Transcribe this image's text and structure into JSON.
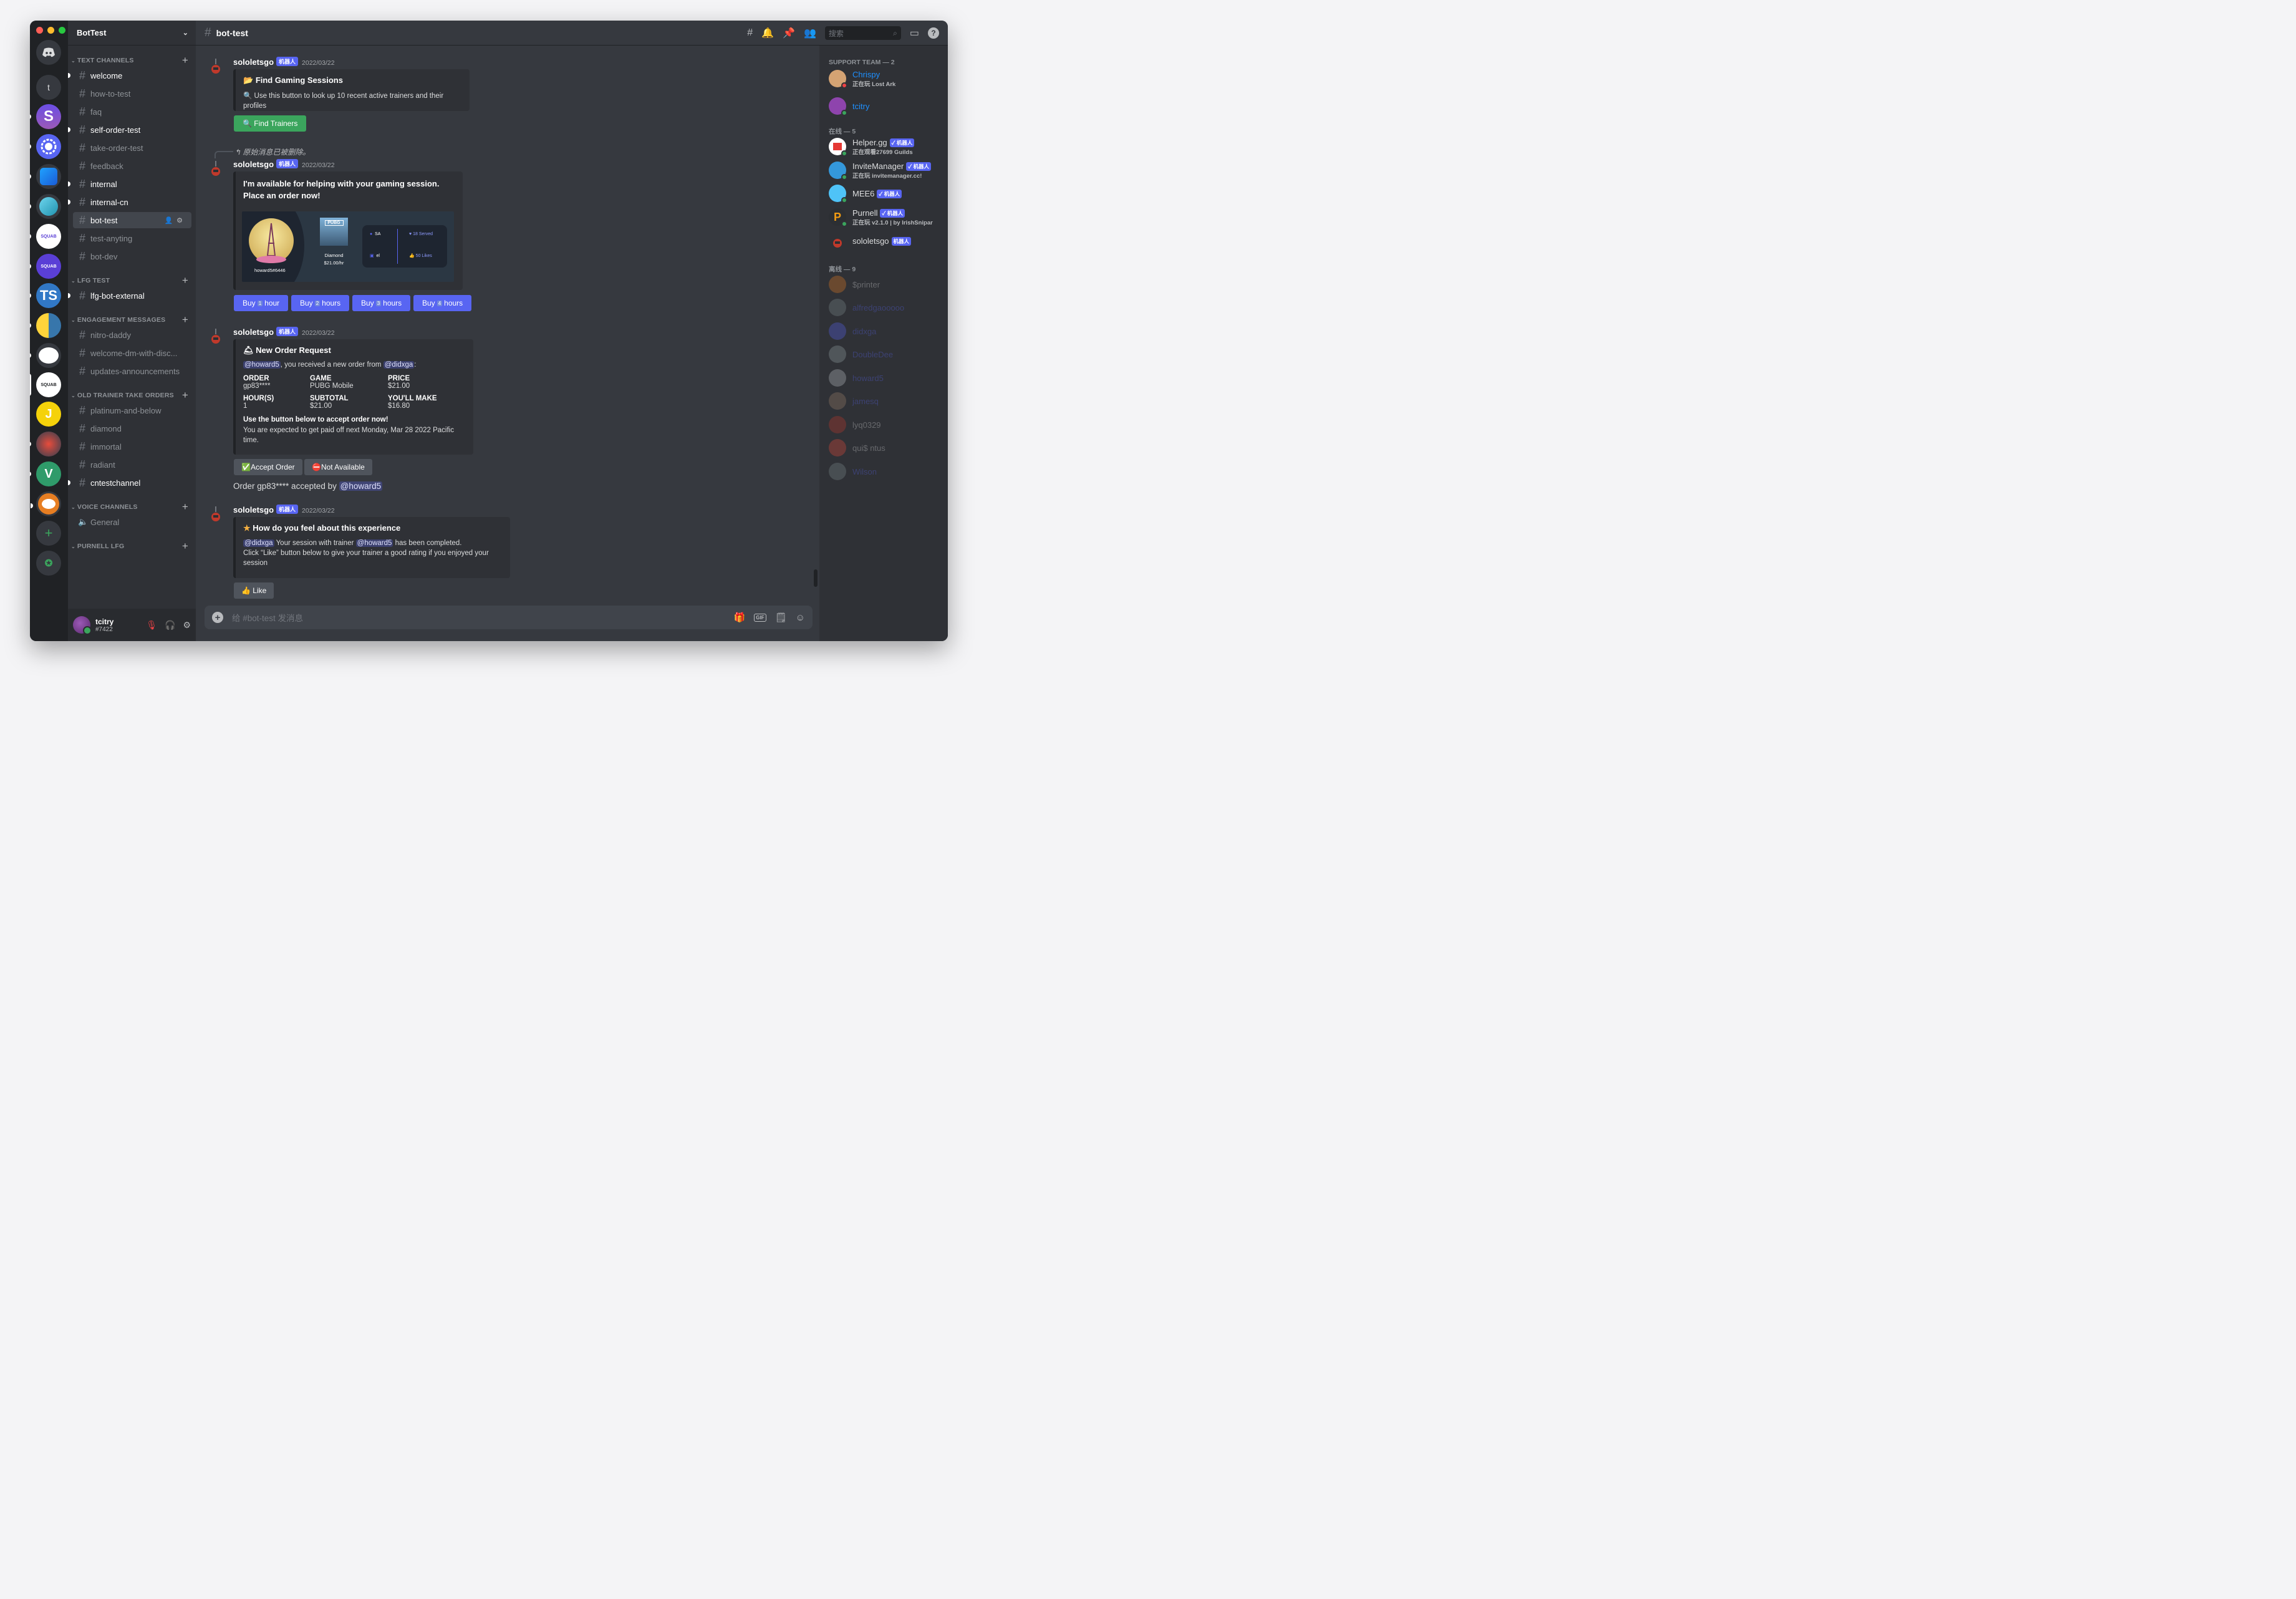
{
  "guild": {
    "name": "BotTest"
  },
  "rail": {
    "servers": [
      {
        "name": "Direct Messages",
        "label": "",
        "bg": "#36393f"
      },
      {
        "name": "t",
        "label": "t",
        "bg": "#36393f"
      },
      {
        "name": "S Team",
        "label": "S",
        "bg": "#6b4ee6"
      },
      {
        "name": "Discord",
        "label": "",
        "bg": "#5865f2"
      },
      {
        "name": "Xcode",
        "label": "",
        "bg": "#1f8ceb"
      },
      {
        "name": "Bubble",
        "label": "",
        "bg": "#3ea8c4"
      },
      {
        "name": "Squad",
        "label": "SQUAB",
        "bg": "#ffffff"
      },
      {
        "name": "Squad 2",
        "label": "SQUAB",
        "bg": "#5a3fd6"
      },
      {
        "name": "TS",
        "label": "TS",
        "bg": "#3178c6"
      },
      {
        "name": "Python",
        "label": "",
        "bg": "#3776ab"
      },
      {
        "name": "Reddit",
        "label": "",
        "bg": "#36393f"
      },
      {
        "name": "BotTest",
        "label": "SQUAB",
        "bg": "#ffffff"
      },
      {
        "name": "J",
        "label": "J",
        "bg": "#f5d20a"
      },
      {
        "name": "Art",
        "label": "",
        "bg": "#c0392b"
      },
      {
        "name": "Vue",
        "label": "V",
        "bg": "#2f9b6a"
      },
      {
        "name": "Owl",
        "label": "",
        "bg": "#e67e22"
      }
    ]
  },
  "channels": {
    "text_category": "TEXT CHANNELS",
    "lfg_category": "LFG TEST",
    "engagement_category": "ENGAGEMENT MESSAGES",
    "old_trainer_category": "OLD TRAINER TAKE ORDERS",
    "voice_category": "VOICE CHANNELS",
    "purnell_category": "PURNELL LFG",
    "text": [
      "welcome",
      "how-to-test",
      "faq",
      "self-order-test",
      "take-order-test",
      "feedback",
      "internal",
      "internal-cn",
      "bot-test",
      "test-anyting",
      "bot-dev"
    ],
    "lfg": [
      "lfg-bot-external"
    ],
    "engagement": [
      "nitro-daddy",
      "welcome-dm-with-disc...",
      "updates-announcements"
    ],
    "old_trainer": [
      "platinum-and-below",
      "diamond",
      "immortal",
      "radiant",
      "cntestchannel"
    ],
    "voice": [
      "General"
    ]
  },
  "user": {
    "name": "tcitry",
    "tag": "#7422"
  },
  "topbar": {
    "channel": "bot-test",
    "search_placeholder": "搜索"
  },
  "messages": {
    "author": "sololetsgo",
    "bot_badge": "机器人",
    "m1": {
      "time": "2022/03/22",
      "title": "Find Gaming Sessions",
      "desc": "Use this button to look up 10 recent active trainers and their profiles",
      "button": "Find Trainers"
    },
    "m2": {
      "reply": "原始消息已被删除。",
      "time": "2022/03/22",
      "title": "I'm available for helping with your gaming session. Place an order now!",
      "card": {
        "handle": "howard5#6446",
        "game_logo": "PUBG",
        "rank": "Diamond",
        "rate": "$21.00/hr",
        "region": "SA",
        "lang": "el",
        "served": "18 Served",
        "likes": "50 Likes"
      },
      "buttons": [
        {
          "pre": "Buy",
          "n": "1",
          "post": "hour"
        },
        {
          "pre": "Buy",
          "n": "2",
          "post": "hours"
        },
        {
          "pre": "Buy",
          "n": "3",
          "post": "hours"
        },
        {
          "pre": "Buy",
          "n": "4",
          "post": "hours"
        }
      ]
    },
    "m3": {
      "time": "2022/03/22",
      "title": "New Order Request",
      "mention1": "@howard5",
      "mid": ", you received a new order from",
      "mention2": "@didxga",
      "tail": ":",
      "order_h": "ORDER",
      "order_v": "gp83****",
      "game_h": "GAME",
      "game_v": "PUBG Mobile",
      "price_h": "PRICE",
      "price_v": "$21.00",
      "hours_h": "HOUR(S)",
      "hours_v": "1",
      "subtotal_h": "SUBTOTAL",
      "subtotal_v": "$21.00",
      "make_h": "YOU'LL MAKE",
      "make_v": "$16.80",
      "cta": "Use the button below to accept order now!",
      "note": "You are expected to get paid off next Monday, Mar 28 2022 Pacific time.",
      "accept": "Accept Order",
      "decline": "Not Available",
      "accepted_text": "Order gp83**** accepted by",
      "accepted_by": "@howard5"
    },
    "m4": {
      "time": "2022/03/22",
      "title": "How do you feel about this experience",
      "mention1": "@didxga",
      "mid": "Your session with trainer",
      "mention2": "@howard5",
      "tail": "has been completed.",
      "line2": "Click “Like” button below to give your trainer a good rating if you enjoyed your session",
      "button": "Like"
    }
  },
  "composer": {
    "placeholder": "给 #bot-test 发消息"
  },
  "members": {
    "support_header": "SUPPORT TEAM — 2",
    "online_header": "在线 — 5",
    "offline_header": "离线 — 9",
    "support": [
      {
        "name": "Chrispy",
        "status": "正在玩 Lost Ark",
        "color": "#1e90ff",
        "bg": "#d4a373"
      },
      {
        "name": "tcitry",
        "status": "",
        "color": "#1e90ff",
        "bg": "#8e44ad"
      }
    ],
    "online": [
      {
        "name": "Helper.gg",
        "status": "正在观看27699 Guilds",
        "badge": "✓ 机器人",
        "bg": "#e53935"
      },
      {
        "name": "InviteManager",
        "status": "正在玩 invitemanager.cc!",
        "badge": "✓ 机器人",
        "bg": "#3498db"
      },
      {
        "name": "MEE6",
        "status": "",
        "badge": "✓ 机器人",
        "bg": "#4fc3f7"
      },
      {
        "name": "Purnell",
        "status": "正在玩 v2.1.0 | by IrishSnipar",
        "badge": "✓ 机器人",
        "bg": "#f39c12"
      },
      {
        "name": "sololetsgo",
        "status": "",
        "badge": "机器人",
        "bg": "#c0392b"
      }
    ],
    "offline": [
      {
        "name": "$printer",
        "bg": "#e67e22",
        "color": "#dcddde"
      },
      {
        "name": "alfredgaooooo",
        "bg": "#7f8c8d",
        "color": "#5865f2"
      },
      {
        "name": "didxga",
        "bg": "#5865f2",
        "color": "#5865f2"
      },
      {
        "name": "DoubleDee",
        "bg": "#95a5a6",
        "color": "#5865f2"
      },
      {
        "name": "howard5",
        "bg": "#bdc3c7",
        "color": "#5865f2"
      },
      {
        "name": "jamesq",
        "bg": "#a0826d",
        "color": "#5865f2"
      },
      {
        "name": "lyq0329",
        "bg": "#c0392b",
        "color": "#dcddde"
      },
      {
        "name": "qui$ ntus",
        "bg": "#e74c3c",
        "color": "#dcddde"
      },
      {
        "name": "Wilson",
        "bg": "#7f8c8d",
        "color": "#5865f2"
      }
    ]
  }
}
